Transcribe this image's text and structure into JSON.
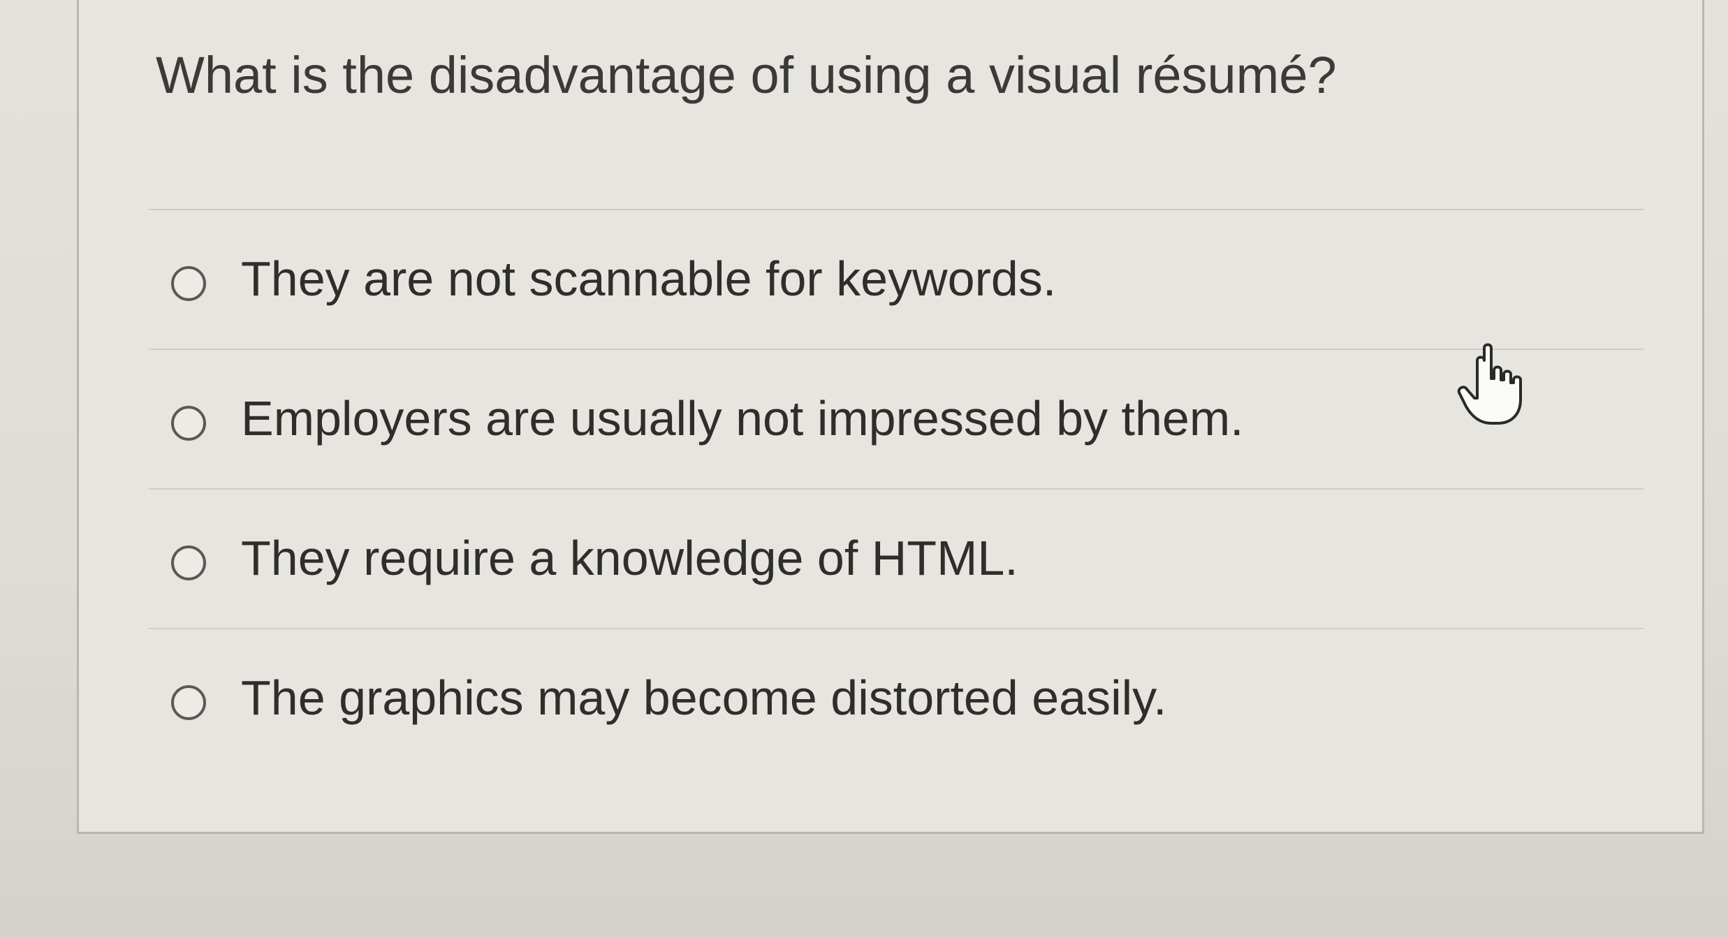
{
  "question": {
    "text": "What is the disadvantage of using a visual résumé?"
  },
  "answers": [
    {
      "label": "They are not scannable for keywords.",
      "selected": false
    },
    {
      "label": "Employers are usually not impressed by them.",
      "selected": false
    },
    {
      "label": "They require a knowledge of HTML.",
      "selected": false
    },
    {
      "label": "The graphics may become distorted easily.",
      "selected": false
    }
  ],
  "cursor": {
    "icon": "hand-pointer-icon"
  }
}
